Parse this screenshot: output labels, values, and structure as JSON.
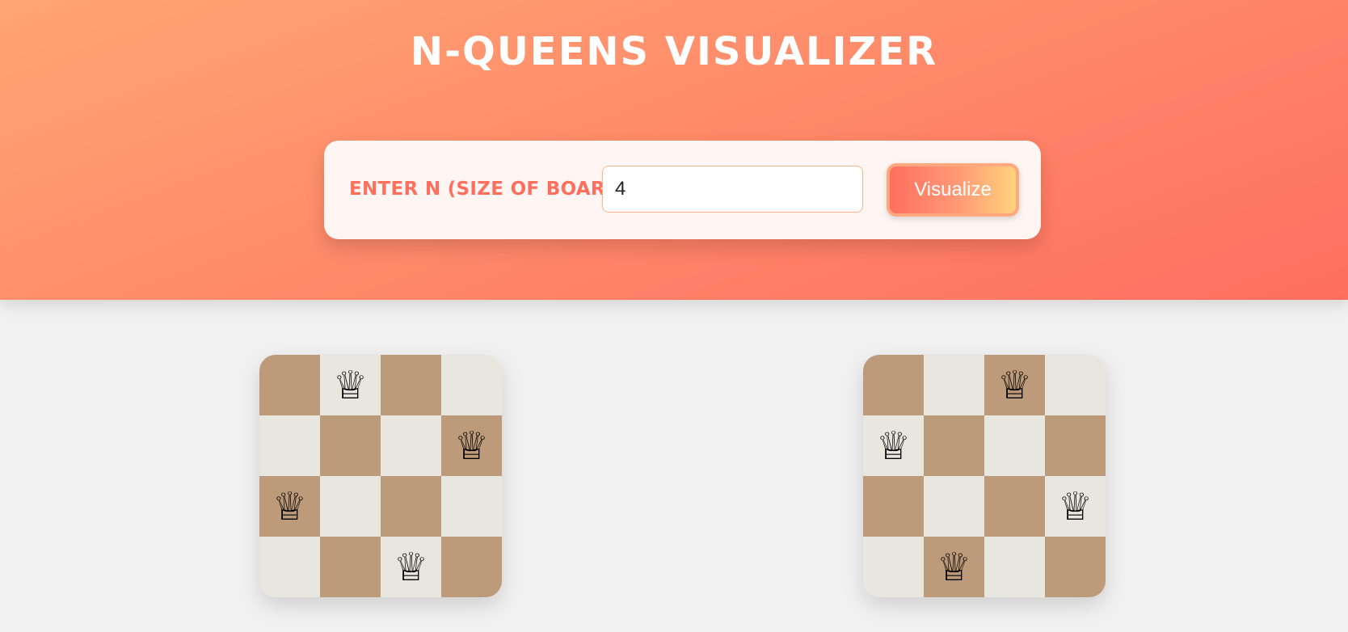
{
  "header": {
    "title": "N-QUEENS VISUALIZER"
  },
  "controls": {
    "label": "ENTER N (SIZE OF BOARD):",
    "input_value": "4",
    "button_label": "Visualize"
  },
  "queen_glyph": "♕",
  "queen_icon": "queen-icon",
  "colors": {
    "header_start": "#ffa572",
    "header_end": "#ff6f5e",
    "label": "#ff6f5e",
    "dark_square": "#bd9a7a",
    "light_square": "#e8e7df"
  },
  "boards": [
    {
      "n": 4,
      "queen_columns": [
        1,
        3,
        0,
        2
      ]
    },
    {
      "n": 4,
      "queen_columns": [
        2,
        0,
        3,
        1
      ]
    }
  ]
}
